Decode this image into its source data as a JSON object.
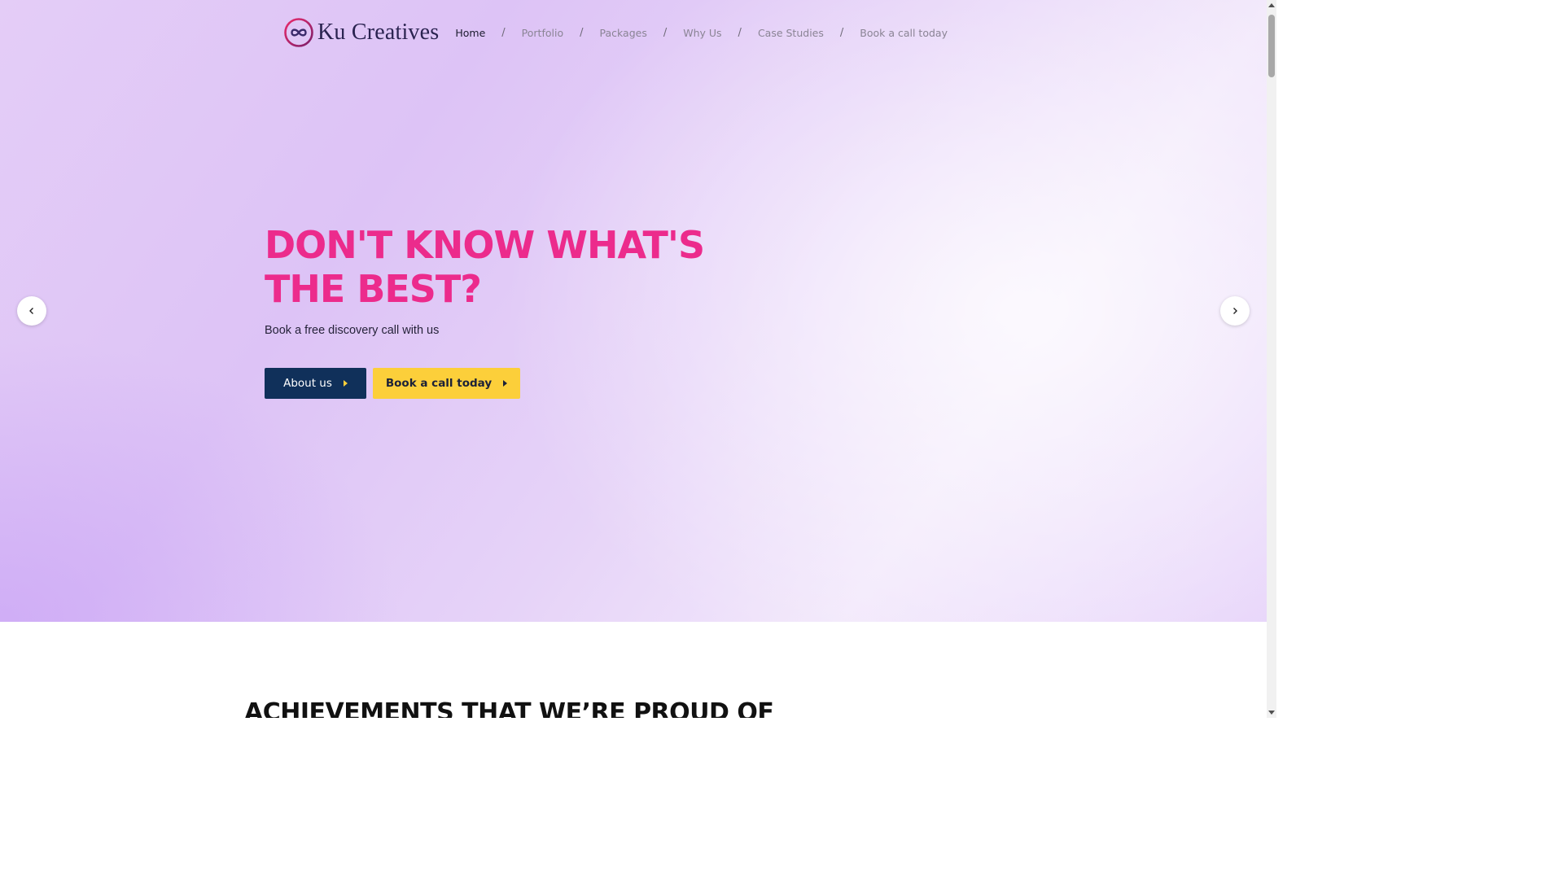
{
  "brand": {
    "name": "Ku Creatives",
    "accent_color": "#ec2b8c",
    "logo_icon": "infinity-ring-icon"
  },
  "nav": {
    "items": [
      {
        "label": "Home",
        "active": true
      },
      {
        "label": "Portfolio",
        "active": false
      },
      {
        "label": "Packages",
        "active": false
      },
      {
        "label": "Why Us",
        "active": false
      },
      {
        "label": "Case Studies",
        "active": false
      },
      {
        "label": "Book a call today",
        "active": false
      }
    ],
    "separator": "/"
  },
  "hero": {
    "title": "DON'T KNOW WHAT'S THE BEST?",
    "subtitle": "Book a free discovery call with us",
    "buttons": {
      "about_label": "About us",
      "call_label": "Book a call today"
    },
    "colors": {
      "about_bg": "#10305a",
      "call_bg": "#fccf3a"
    },
    "carousel": {
      "prev_icon": "chevron-left-icon",
      "next_icon": "chevron-right-icon"
    }
  },
  "achievements": {
    "title": "ACHIEVEMENTS THAT WE’RE PROUD OF"
  }
}
